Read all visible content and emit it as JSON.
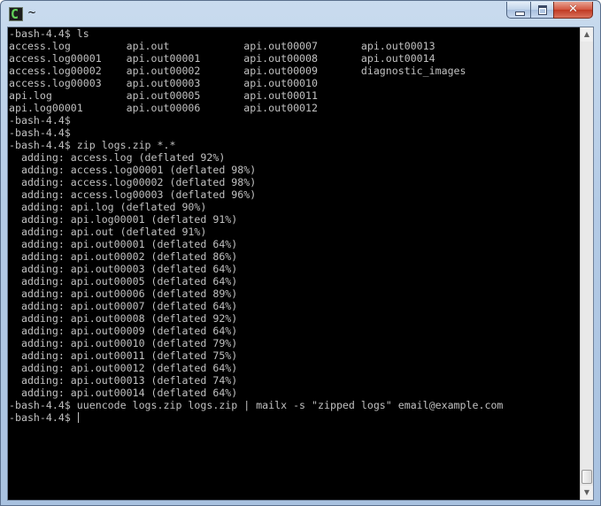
{
  "window": {
    "title": "~",
    "icon": "cygwin-terminal-icon",
    "controls": {
      "minimize_icon": "minimize-icon",
      "maximize_icon": "maximize-icon",
      "close_icon": "close-icon",
      "close_glyph": "✕"
    }
  },
  "colors": {
    "terminal_bg": "#000000",
    "terminal_fg": "#c0c0c0",
    "close_button": "#c9452e",
    "titlebar": "#b9cfe8"
  },
  "terminal": {
    "lines": [
      "-bash-4.4$ ls",
      "access.log         api.out            api.out00007       api.out00013",
      "access.log00001    api.out00001       api.out00008       api.out00014",
      "access.log00002    api.out00002       api.out00009       diagnostic_images",
      "access.log00003    api.out00003       api.out00010",
      "api.log            api.out00005       api.out00011",
      "api.log00001       api.out00006       api.out00012",
      "-bash-4.4$",
      "-bash-4.4$",
      "-bash-4.4$ zip logs.zip *.*",
      "  adding: access.log (deflated 92%)",
      "  adding: access.log00001 (deflated 98%)",
      "  adding: access.log00002 (deflated 98%)",
      "  adding: access.log00003 (deflated 96%)",
      "  adding: api.log (deflated 90%)",
      "  adding: api.log00001 (deflated 91%)",
      "  adding: api.out (deflated 91%)",
      "  adding: api.out00001 (deflated 64%)",
      "  adding: api.out00002 (deflated 86%)",
      "  adding: api.out00003 (deflated 64%)",
      "  adding: api.out00005 (deflated 64%)",
      "  adding: api.out00006 (deflated 89%)",
      "  adding: api.out00007 (deflated 64%)",
      "  adding: api.out00008 (deflated 92%)",
      "  adding: api.out00009 (deflated 64%)",
      "  adding: api.out00010 (deflated 79%)",
      "  adding: api.out00011 (deflated 75%)",
      "  adding: api.out00012 (deflated 64%)",
      "  adding: api.out00013 (deflated 74%)",
      "  adding: api.out00014 (deflated 64%)",
      "-bash-4.4$ uuencode logs.zip logs.zip | mailx -s \"zipped logs\" email@example.com"
    ],
    "prompt": "-bash-4.4$ "
  },
  "scrollbar": {
    "up_icon": "scroll-up-arrow-icon",
    "down_icon": "scroll-down-arrow-icon"
  }
}
